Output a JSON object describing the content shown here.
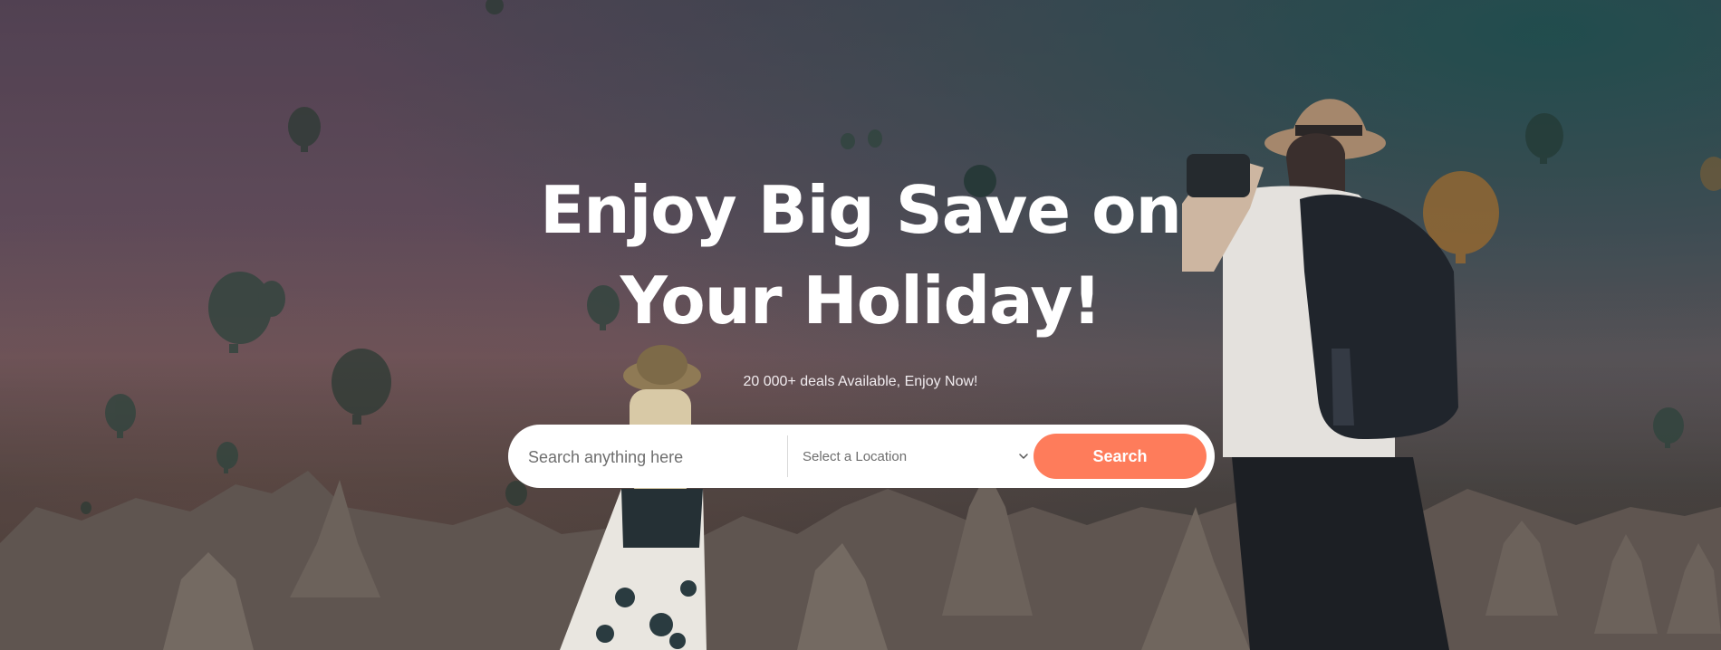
{
  "hero": {
    "headline": "Enjoy Big Save on Your Holiday!",
    "subheadline": "20 000+ deals Available, Enjoy Now!",
    "background_image": "travel-balloons-photo"
  },
  "search": {
    "placeholder": "Search anything here",
    "value": "",
    "location_label": "Select a Location",
    "location_icon": "chevron-down-icon",
    "button_label": "Search"
  },
  "colors": {
    "accent": "#fe7c5b",
    "headline": "#ffffff",
    "search_bar": "#ffffff",
    "placeholder": "#6e6e6e"
  }
}
